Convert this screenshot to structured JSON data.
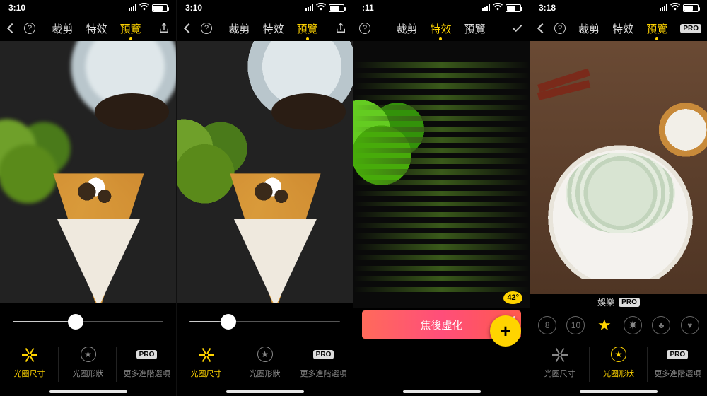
{
  "screens": [
    {
      "status": {
        "time": "3:10",
        "battery_pct": 65
      },
      "nav": {
        "back": true,
        "help": true,
        "tabs": [
          "裁剪",
          "特效",
          "預覽"
        ],
        "active": 2,
        "right_icon": "share"
      },
      "slider": {
        "value": 0.42
      },
      "tools": {
        "items": [
          {
            "label": "光圈尺寸",
            "icon": "aperture"
          },
          {
            "label": "光圈形狀",
            "icon": "star-circle"
          },
          {
            "label": "更多進階選項",
            "icon": "pro"
          }
        ],
        "active": 0
      }
    },
    {
      "status": {
        "time": "3:10",
        "battery_pct": 65
      },
      "nav": {
        "back": true,
        "help": true,
        "tabs": [
          "裁剪",
          "特效",
          "預覽"
        ],
        "active": 2,
        "right_icon": "share"
      },
      "slider": {
        "value": 0.26
      },
      "tools": {
        "items": [
          {
            "label": "光圈尺寸",
            "icon": "aperture"
          },
          {
            "label": "光圈形狀",
            "icon": "star-circle"
          },
          {
            "label": "更多進階選項",
            "icon": "pro"
          }
        ],
        "active": 0
      }
    },
    {
      "status": {
        "time": ":11",
        "battery_pct": 62
      },
      "nav": {
        "back": false,
        "help": true,
        "tabs": [
          "裁剪",
          "特效",
          "預覽"
        ],
        "active": 1,
        "right_icon": "check"
      },
      "depth_badge": "42°",
      "effect_button": "焦後虛化",
      "fab": "+"
    },
    {
      "status": {
        "time": "3:18",
        "battery_pct": 60
      },
      "nav": {
        "back": true,
        "help": true,
        "tabs": [
          "裁剪",
          "特效",
          "預覽"
        ],
        "active": 2,
        "right_icon": "pro"
      },
      "shape_header": {
        "label": "娛樂",
        "badge": "PRO"
      },
      "shapes": [
        {
          "kind": "number",
          "label": "8"
        },
        {
          "kind": "number",
          "label": "10"
        },
        {
          "kind": "star",
          "active": true
        },
        {
          "kind": "burst"
        },
        {
          "kind": "club"
        },
        {
          "kind": "heart"
        }
      ],
      "tools": {
        "items": [
          {
            "label": "光圈尺寸",
            "icon": "aperture"
          },
          {
            "label": "光圈形狀",
            "icon": "star-circle"
          },
          {
            "label": "更多進階選項",
            "icon": "pro"
          }
        ],
        "active": 1
      }
    }
  ],
  "icons": {
    "pro_label": "PRO"
  }
}
